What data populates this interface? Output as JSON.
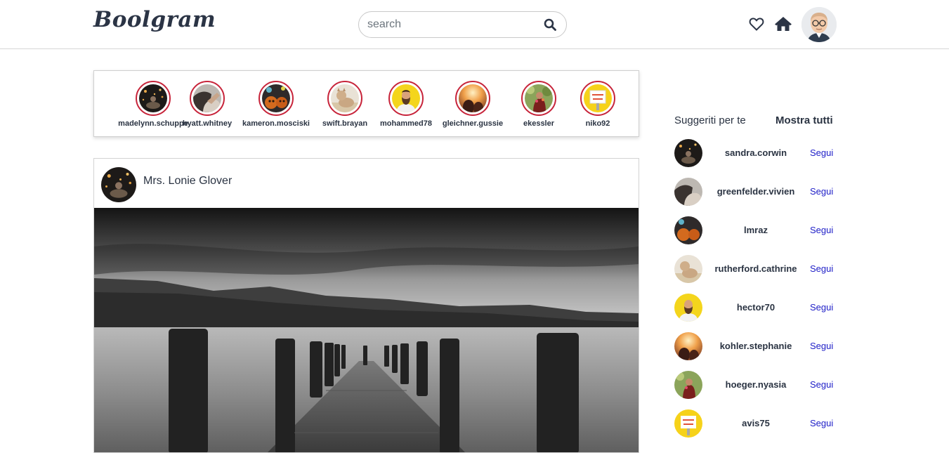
{
  "header": {
    "logo": "Boolgram",
    "search_placeholder": "search",
    "icons": [
      "heart-icon",
      "home-icon",
      "search-icon"
    ]
  },
  "stories": [
    {
      "username": "madelynn.schuppe",
      "avatar": "meditation-glow"
    },
    {
      "username": "hyatt.whitney",
      "avatar": "hand-portrait"
    },
    {
      "username": "kameron.mosciski",
      "avatar": "pumpkins"
    },
    {
      "username": "swift.brayan",
      "avatar": "cat-sand"
    },
    {
      "username": "mohammed78",
      "avatar": "bearded-man-yellow"
    },
    {
      "username": "gleichner.gussie",
      "avatar": "sunset-couple"
    },
    {
      "username": "ekessler",
      "avatar": "woman-flowers"
    },
    {
      "username": "niko92",
      "avatar": "no-image-sign"
    }
  ],
  "post": {
    "author": "Mrs. Lonie Glover",
    "image": "black-and-white-pier-lake"
  },
  "suggestions": {
    "title": "Suggeriti per te",
    "show_all": "Mostra tutti",
    "follow_label": "Segui",
    "users": [
      {
        "username": "sandra.corwin",
        "avatar": "meditation-glow"
      },
      {
        "username": "greenfelder.vivien",
        "avatar": "hand-portrait"
      },
      {
        "username": "lmraz",
        "avatar": "pumpkins"
      },
      {
        "username": "rutherford.cathrine",
        "avatar": "cat-sand"
      },
      {
        "username": "hector70",
        "avatar": "bearded-man-yellow"
      },
      {
        "username": "kohler.stephanie",
        "avatar": "sunset-couple"
      },
      {
        "username": "hoeger.nyasia",
        "avatar": "woman-flowers"
      },
      {
        "username": "avis75",
        "avatar": "no-image-sign"
      }
    ]
  },
  "colors": {
    "story_ring": "#c7243a",
    "follow_link": "#1d1dc7",
    "text": "#2a3342"
  }
}
